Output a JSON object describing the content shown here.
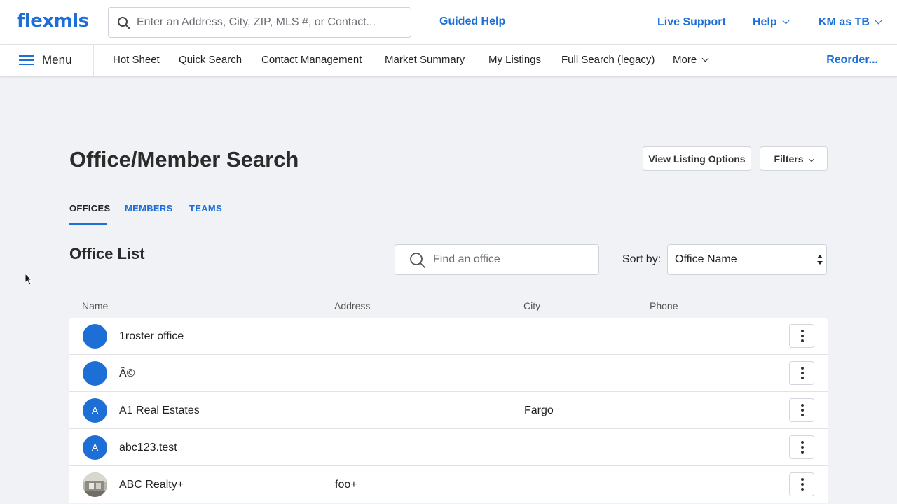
{
  "header": {
    "logo": "flexmls",
    "search_placeholder": "Enter an Address, City, ZIP, MLS #, or Contact...",
    "guided_help": "Guided Help",
    "live_support": "Live Support",
    "help": "Help",
    "user": "KM as TB"
  },
  "nav": {
    "menu_label": "Menu",
    "items": [
      "Hot Sheet",
      "Quick Search",
      "Contact Management",
      "Market Summary",
      "My Listings",
      "Full Search (legacy)",
      "More"
    ],
    "reorder": "Reorder..."
  },
  "page": {
    "title": "Office/Member Search",
    "view_listing_options": "View Listing Options",
    "filters": "Filters",
    "tabs": [
      "OFFICES",
      "MEMBERS",
      "TEAMS"
    ],
    "active_tab": "OFFICES"
  },
  "office_list": {
    "title": "Office List",
    "find_placeholder": "Find an office",
    "sort_label": "Sort by:",
    "sort_value": "Office Name",
    "columns": [
      "Name",
      "Address",
      "City",
      "Phone"
    ],
    "rows": [
      {
        "avatar": "",
        "name": "1roster office",
        "address": "",
        "city": "",
        "phone": ""
      },
      {
        "avatar": "",
        "name": "Â©",
        "address": "",
        "city": "",
        "phone": ""
      },
      {
        "avatar": "A",
        "name": "A1 Real Estates",
        "address": "",
        "city": "Fargo",
        "phone": ""
      },
      {
        "avatar": "A",
        "name": "abc123.test",
        "address": "",
        "city": "",
        "phone": ""
      },
      {
        "avatar": "photo",
        "name": "ABC Realty+",
        "address": "foo+",
        "city": "",
        "phone": ""
      }
    ]
  },
  "colors": {
    "accent": "#1d6fd6",
    "background": "#f1f2f5",
    "text": "#222222"
  }
}
